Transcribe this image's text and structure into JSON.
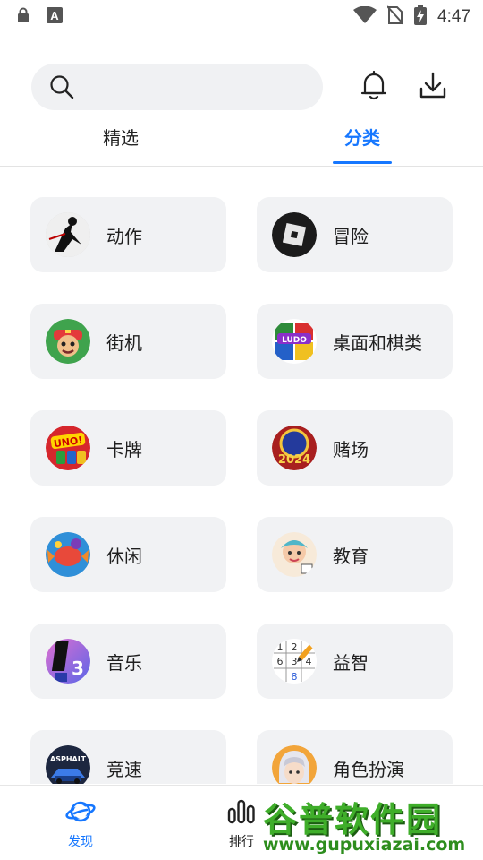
{
  "status_bar": {
    "time": "4:47",
    "icons": [
      "lock-icon",
      "font-icon",
      "wifi-icon",
      "no-sim-icon",
      "battery-charging-icon"
    ]
  },
  "header": {
    "search": {
      "placeholder": "",
      "value": ""
    },
    "icons": [
      "search-icon",
      "bell-icon",
      "download-icon"
    ]
  },
  "tabs": [
    {
      "label": "精选",
      "active": false
    },
    {
      "label": "分类",
      "active": true
    }
  ],
  "accent_color": "#1677ff",
  "categories": [
    {
      "label": "动作",
      "icon": "action-game-thumb"
    },
    {
      "label": "冒险",
      "icon": "adventure-game-thumb"
    },
    {
      "label": "街机",
      "icon": "arcade-game-thumb"
    },
    {
      "label": "桌面和棋类",
      "icon": "board-game-thumb"
    },
    {
      "label": "卡牌",
      "icon": "card-game-thumb"
    },
    {
      "label": "赌场",
      "icon": "casino-game-thumb"
    },
    {
      "label": "休闲",
      "icon": "casual-game-thumb"
    },
    {
      "label": "教育",
      "icon": "education-game-thumb"
    },
    {
      "label": "音乐",
      "icon": "music-game-thumb"
    },
    {
      "label": "益智",
      "icon": "puzzle-game-thumb"
    },
    {
      "label": "竞速",
      "icon": "racing-game-thumb"
    },
    {
      "label": "角色扮演",
      "icon": "roleplay-game-thumb"
    }
  ],
  "bottom_nav": [
    {
      "label": "发现",
      "icon": "planet-icon",
      "active": true
    },
    {
      "label": "排行",
      "icon": "ranking-icon",
      "active": false
    }
  ],
  "watermark": {
    "title": "谷普软件园",
    "url": "www.gupuxiazai.com"
  }
}
